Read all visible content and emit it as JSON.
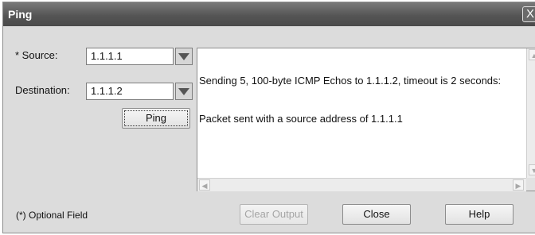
{
  "window": {
    "title": "Ping",
    "close_label": "X"
  },
  "form": {
    "source_label": "* Source:",
    "source_value": "1.1.1.1",
    "destination_label": "Destination:",
    "destination_value": "1.1.1.2",
    "ping_label": "Ping",
    "optional_note": "(*) Optional Field"
  },
  "output": {
    "lines": [
      "Sending 5, 100-byte ICMP Echos to 1.1.1.2, timeout is 2 seconds:",
      "Packet sent with a source address of 1.1.1.1"
    ]
  },
  "buttons": {
    "clear_output": "Clear Output",
    "close": "Close",
    "help": "Help"
  },
  "icons": {
    "dropdown": "chevron-down-icon",
    "scroll_up": "scroll-up-icon",
    "scroll_down": "scroll-down-icon",
    "scroll_left": "scroll-left-icon",
    "scroll_right": "scroll-right-icon"
  }
}
